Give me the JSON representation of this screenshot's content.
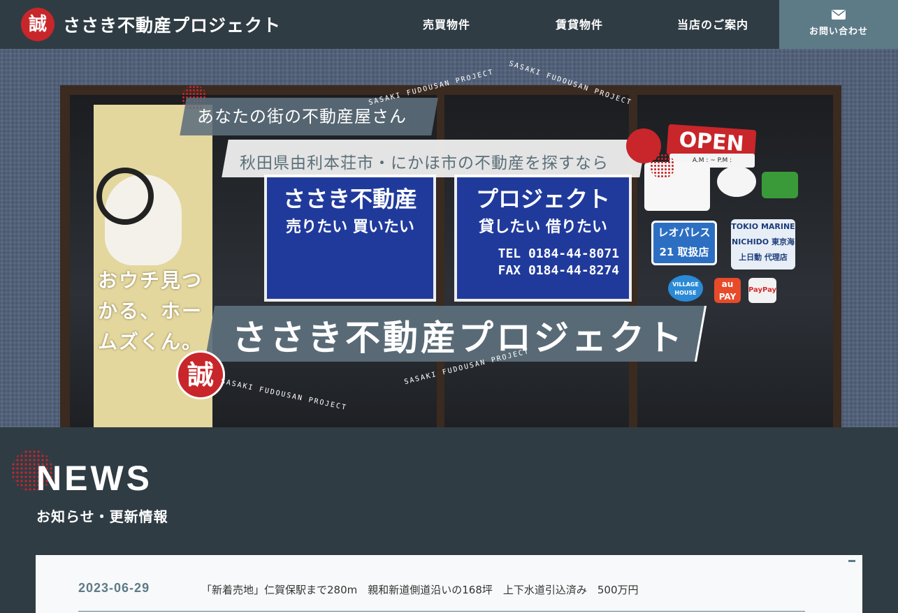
{
  "header": {
    "logo_seal": "誠",
    "site_name": "ささき不動産プロジェクト",
    "nav": [
      {
        "label": "売買物件"
      },
      {
        "label": "賃貸物件"
      },
      {
        "label": "当店のご案内"
      }
    ],
    "contact_label": "お問い合わせ",
    "contact_icon": "envelope-icon"
  },
  "hero": {
    "tagline": "あなたの街の不動産屋さん",
    "sub_tagline": "秋田県由利本荘市・にかほ市の不動産を探すなら",
    "brand_title": "ささき不動産プロジェクト",
    "brand_seal": "誠",
    "orbit_text": "SASAKI FUDOUSAN PROJECT",
    "photo": {
      "banner_text": "おウチ見つかる、ホームズくん。",
      "sign_left_title": "ささき不動産",
      "sign_left_sub": "売りたい 買いたい",
      "sign_right_title": "プロジェクト",
      "sign_right_sub": "貸したい 借りたい",
      "tel": "TEL 0184-44-8071",
      "fax": "FAX 0184-44-8274",
      "open_sign": "OPEN",
      "open_hours": "A.M  :  ~ P.M  :",
      "decal_leopalace": "レオパレス21 取扱店",
      "decal_tokio": "TOKIO MARINE NICHIDO 東京海上日動 代理店",
      "decal_au_pay": "au PAY",
      "decal_village": "VILLAGE HOUSE",
      "decal_paypay": "PayPay"
    }
  },
  "news": {
    "title": "NEWS",
    "subtitle": "お知らせ・更新情報",
    "items": [
      {
        "date": "2023-06-29",
        "text": "「新着売地」仁賀保駅まで280m　親和新道側道沿いの168坪　上下水道引込済み　500万円"
      }
    ]
  },
  "colors": {
    "header_bg": "#2f3c44",
    "accent_red": "#c8262a",
    "accent_slate": "#5d7a87",
    "panel_bg": "#f8f9fa"
  }
}
